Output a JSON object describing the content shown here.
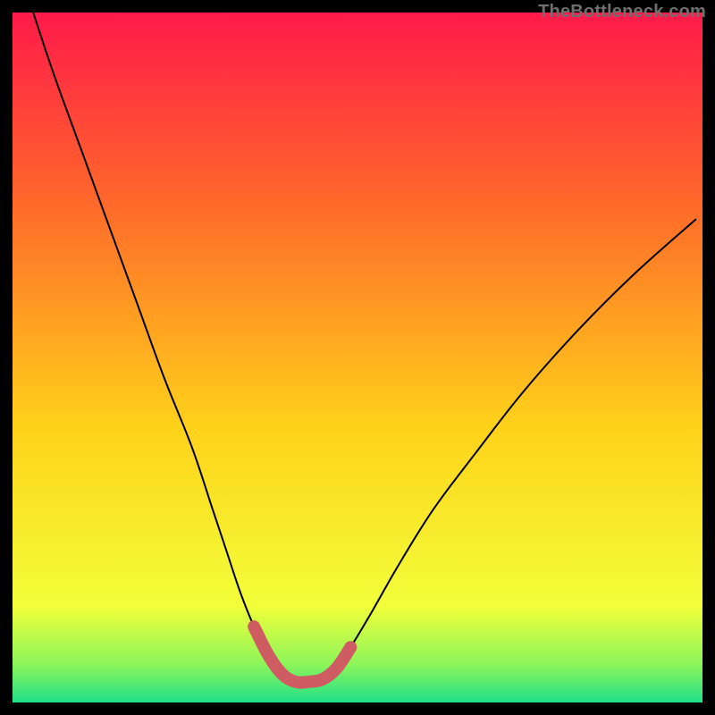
{
  "watermark": "TheBottleneck.com",
  "colors": {
    "bg": "#000000",
    "grad_top": "#ff1a4a",
    "grad_upper": "#ff6a2a",
    "grad_mid": "#ffd21a",
    "grad_lower": "#f2ff3a",
    "grad_green1": "#8cf55a",
    "grad_green2": "#1fe08a",
    "curve": "#000000",
    "accent": "#cf5b63"
  },
  "chart_data": {
    "type": "line",
    "title": "",
    "xlabel": "",
    "ylabel": "",
    "xlim": [
      0,
      100
    ],
    "ylim": [
      0,
      100
    ],
    "grid": false,
    "series": [
      {
        "name": "bottleneck-curve",
        "x": [
          3,
          6,
          10,
          14,
          18,
          22,
          26,
          29,
          31,
          33,
          35,
          37,
          39,
          41,
          43,
          45,
          47,
          49,
          52,
          56,
          61,
          67,
          74,
          82,
          90,
          99
        ],
        "y": [
          100,
          91,
          80,
          69,
          58,
          47,
          37,
          28,
          22,
          16,
          11,
          7,
          4.2,
          3,
          3,
          3.4,
          5,
          8,
          13,
          20,
          28,
          36,
          45,
          54,
          62,
          70
        ]
      }
    ],
    "annotations": [
      {
        "name": "valley-highlight",
        "x": [
          35,
          37,
          39,
          41,
          43,
          45,
          47,
          49
        ],
        "y": [
          11,
          7,
          4.2,
          3,
          3,
          3.4,
          5,
          8
        ]
      }
    ]
  }
}
